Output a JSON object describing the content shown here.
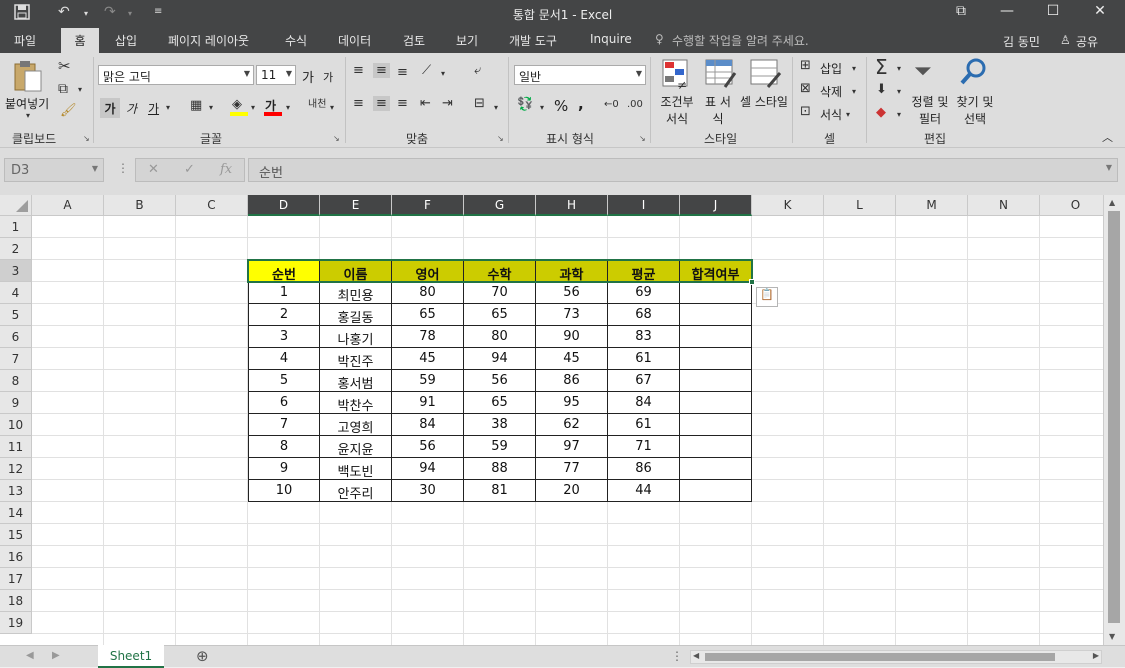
{
  "title_bar": {
    "title": "통합 문서1 - Excel",
    "quick_access": [
      "save-icon",
      "undo-icon",
      "redo-icon",
      "customize-icon"
    ],
    "window_buttons": [
      "restore-ribbon-icon",
      "minimize-icon",
      "maximize-icon",
      "close-icon"
    ]
  },
  "tabs": [
    "파일",
    "홈",
    "삽입",
    "페이지 레이아웃",
    "수식",
    "데이터",
    "검토",
    "보기",
    "개발 도구",
    "Inquire"
  ],
  "active_tab": "홈",
  "tell_me": "수행할 작업을 알려 주세요.",
  "user": "김 동민",
  "share": "공유",
  "ribbon": {
    "clipboard": {
      "paste": "붙여넣기",
      "label": "클립보드"
    },
    "font": {
      "name": "맑은 고딕",
      "size": "11",
      "bold": "가",
      "italic": "가",
      "underline": "가",
      "grow": "가",
      "shrink": "가",
      "label": "글꼴",
      "font_color": "가"
    },
    "alignment": {
      "label": "맞춤"
    },
    "number": {
      "format": "일반",
      "percent": "%",
      "comma": ",",
      "label": "표시 형식"
    },
    "styles": {
      "cond": "조건부 서식",
      "table": "표 서식",
      "cell": "셀 스타일",
      "label": "스타일"
    },
    "cells": {
      "insert": "삽입",
      "delete": "삭제",
      "format": "서식",
      "label": "셀"
    },
    "editing": {
      "sort": "정렬 및 필터",
      "find": "찾기 및 선택",
      "label": "편집"
    }
  },
  "formula_bar": {
    "name_box": "D3",
    "content": "순번",
    "fx": "fx"
  },
  "columns": [
    "A",
    "B",
    "C",
    "D",
    "E",
    "F",
    "G",
    "H",
    "I",
    "J",
    "K",
    "L",
    "M",
    "N",
    "O"
  ],
  "rows": [
    "1",
    "2",
    "3",
    "4",
    "5",
    "6",
    "7",
    "8",
    "9",
    "10",
    "11",
    "12",
    "13",
    "14",
    "15",
    "16",
    "17",
    "18",
    "19"
  ],
  "table": {
    "headers": [
      "순번",
      "이름",
      "영어",
      "수학",
      "과학",
      "평균",
      "합격여부"
    ],
    "data": [
      [
        "1",
        "최민용",
        "80",
        "70",
        "56",
        "69",
        ""
      ],
      [
        "2",
        "홍길동",
        "65",
        "65",
        "73",
        "68",
        ""
      ],
      [
        "3",
        "나홍기",
        "78",
        "80",
        "90",
        "83",
        ""
      ],
      [
        "4",
        "박진주",
        "45",
        "94",
        "45",
        "61",
        ""
      ],
      [
        "5",
        "홍서범",
        "59",
        "56",
        "86",
        "67",
        ""
      ],
      [
        "6",
        "박찬수",
        "91",
        "65",
        "95",
        "84",
        ""
      ],
      [
        "7",
        "고영희",
        "84",
        "38",
        "62",
        "61",
        ""
      ],
      [
        "8",
        "윤지윤",
        "56",
        "59",
        "97",
        "71",
        ""
      ],
      [
        "9",
        "백도빈",
        "94",
        "88",
        "77",
        "86",
        ""
      ],
      [
        "10",
        "안주리",
        "30",
        "81",
        "20",
        "44",
        ""
      ]
    ]
  },
  "sheet_tab": "Sheet1",
  "colors": {
    "header_fill": "#cccc00",
    "selected_header": "#ffff00",
    "accent": "#217346"
  }
}
